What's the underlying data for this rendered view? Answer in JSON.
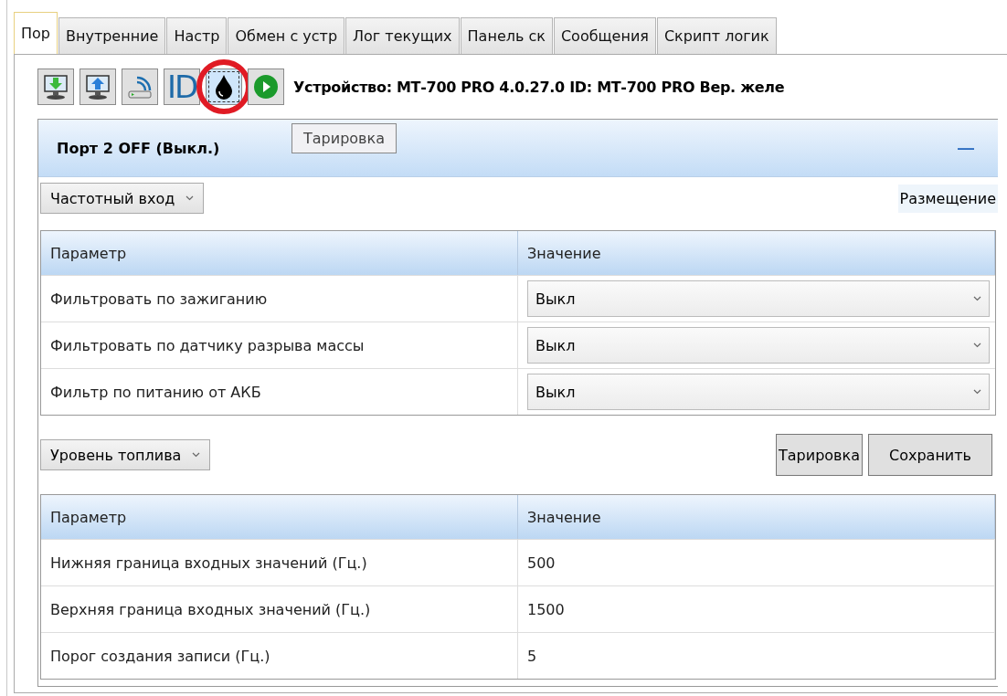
{
  "tabs": [
    {
      "label": "Пор",
      "selected": true
    },
    {
      "label": "Внутренние",
      "selected": false
    },
    {
      "label": "Настр",
      "selected": false
    },
    {
      "label": "Обмен с устр",
      "selected": false
    },
    {
      "label": "Лог текущих",
      "selected": false
    },
    {
      "label": "Панель ск",
      "selected": false
    },
    {
      "label": "Сообщения",
      "selected": false
    },
    {
      "label": "Скрипт логик",
      "selected": false
    }
  ],
  "toolbar": {
    "buttons": [
      {
        "kind": "download",
        "selected": false,
        "highlighted": false
      },
      {
        "kind": "upload",
        "selected": false,
        "highlighted": false
      },
      {
        "kind": "connect",
        "selected": false,
        "highlighted": false
      },
      {
        "kind": "id",
        "label": "ID",
        "selected": false,
        "highlighted": false
      },
      {
        "kind": "drop",
        "selected": true,
        "highlighted": true
      },
      {
        "kind": "play",
        "selected": false,
        "highlighted": false
      }
    ],
    "device": "Устройство: МТ-700 PRO 4.0.27.0 ID: МТ-700 PRO Вер. желе"
  },
  "tooltip": "Тарировка",
  "panel": {
    "title": "Порт 2 OFF (Выкл.)",
    "collapse": "—",
    "mode_dropdown": "Частотный вход",
    "placement": "Размещение",
    "table1": {
      "columns": [
        "Параметр",
        "Значение"
      ],
      "rows": [
        {
          "param": "Фильтровать по зажиганию",
          "value": "Выкл"
        },
        {
          "param": "Фильтровать по датчику разрыва массы",
          "value": "Выкл"
        },
        {
          "param": "Фильтр по питанию от АКБ",
          "value": "Выкл"
        }
      ]
    },
    "sensor_dropdown": "Уровень топлива",
    "buttons": [
      "Тарировка",
      "Сохранить"
    ],
    "table2": {
      "columns": [
        "Параметр",
        "Значение"
      ],
      "rows": [
        {
          "param": "Нижняя граница входных значений (Гц.)",
          "value": "500"
        },
        {
          "param": "Верхняя граница входных значений (Гц.)",
          "value": "1500"
        },
        {
          "param": "Порог создания записи (Гц.)",
          "value": "5"
        }
      ]
    }
  }
}
